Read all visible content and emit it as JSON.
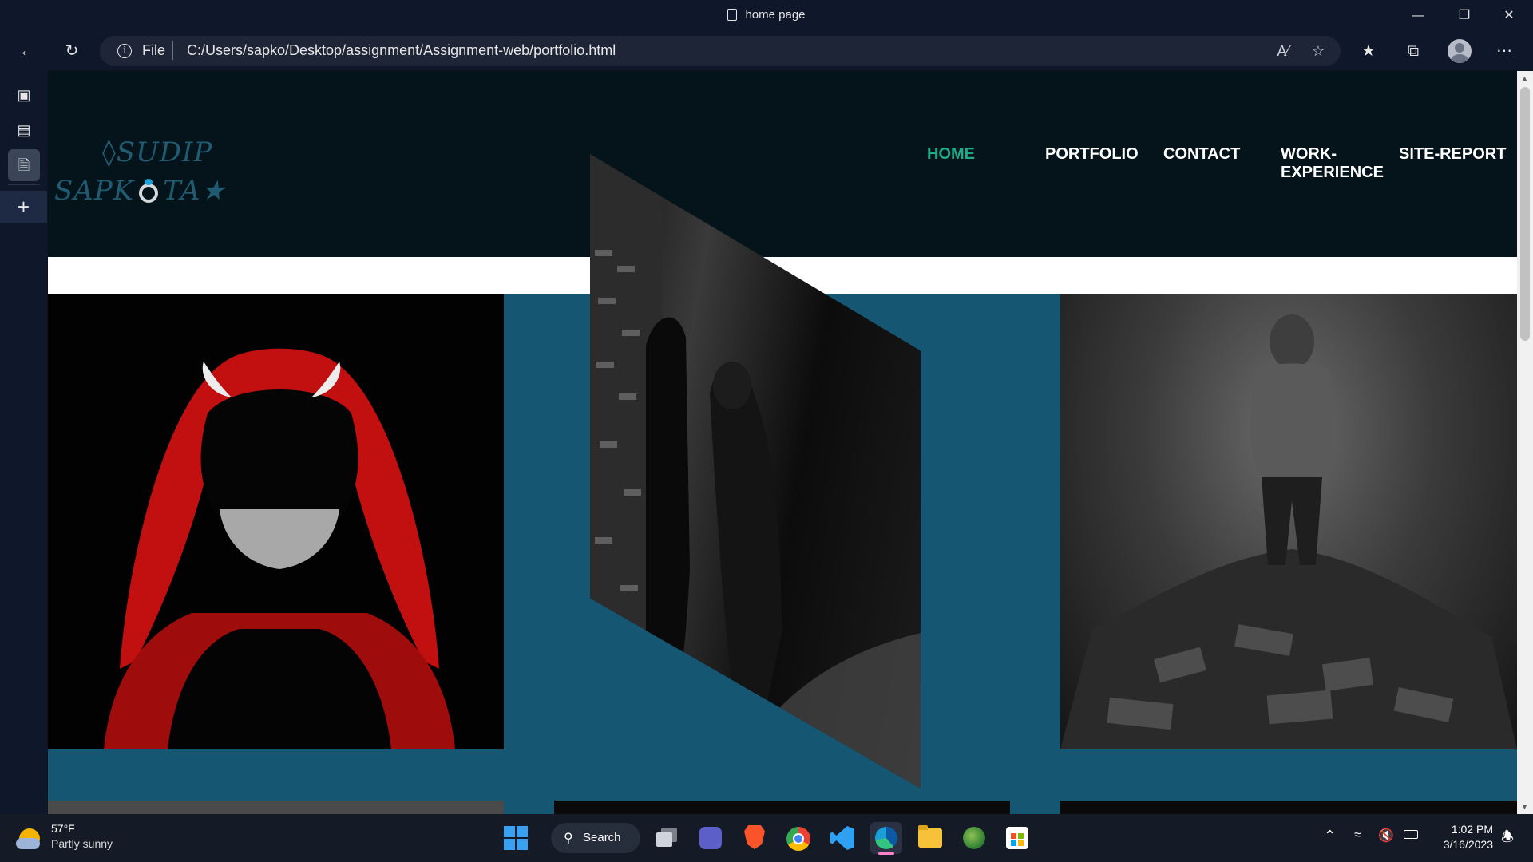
{
  "browser": {
    "window_title": "home page",
    "address": {
      "scheme_label": "File",
      "url": "C:/Users/sapko/Desktop/assignment/Assignment-web/portfolio.html"
    }
  },
  "site": {
    "logo": {
      "line1": "◊SUDIP",
      "line2_part1": "SAPK",
      "line2_part2": "TA★"
    },
    "nav": [
      {
        "label": "HOME",
        "active": true
      },
      {
        "label": "PORTFOLIO",
        "active": false
      },
      {
        "label": "CONTACT",
        "active": false
      },
      {
        "label": "WORK-EXPERIENCE",
        "active": false
      },
      {
        "label": "SITE-REPORT",
        "active": false
      }
    ],
    "colors": {
      "header_bg": "#04141a",
      "page_bg": "#155672",
      "nav_active": "#1faa8a",
      "logo": "#215b72"
    }
  },
  "taskbar": {
    "weather": {
      "temp": "57°F",
      "condition": "Partly sunny"
    },
    "search_label": "Search",
    "clock": {
      "time": "1:02 PM",
      "date": "3/16/2023"
    }
  },
  "icons": [
    "back-icon",
    "refresh-icon",
    "info-icon",
    "read-aloud-icon",
    "add-favorite-icon",
    "favorites-icon",
    "collections-icon",
    "more-icon",
    "minimize-icon",
    "restore-icon",
    "close-icon",
    "windows-start-icon",
    "search-icon",
    "task-view-icon",
    "teams-icon",
    "brave-icon",
    "chrome-icon",
    "vscode-icon",
    "edge-icon",
    "file-explorer-icon",
    "store-icon",
    "wifi-icon",
    "volume-icon",
    "battery-icon"
  ]
}
